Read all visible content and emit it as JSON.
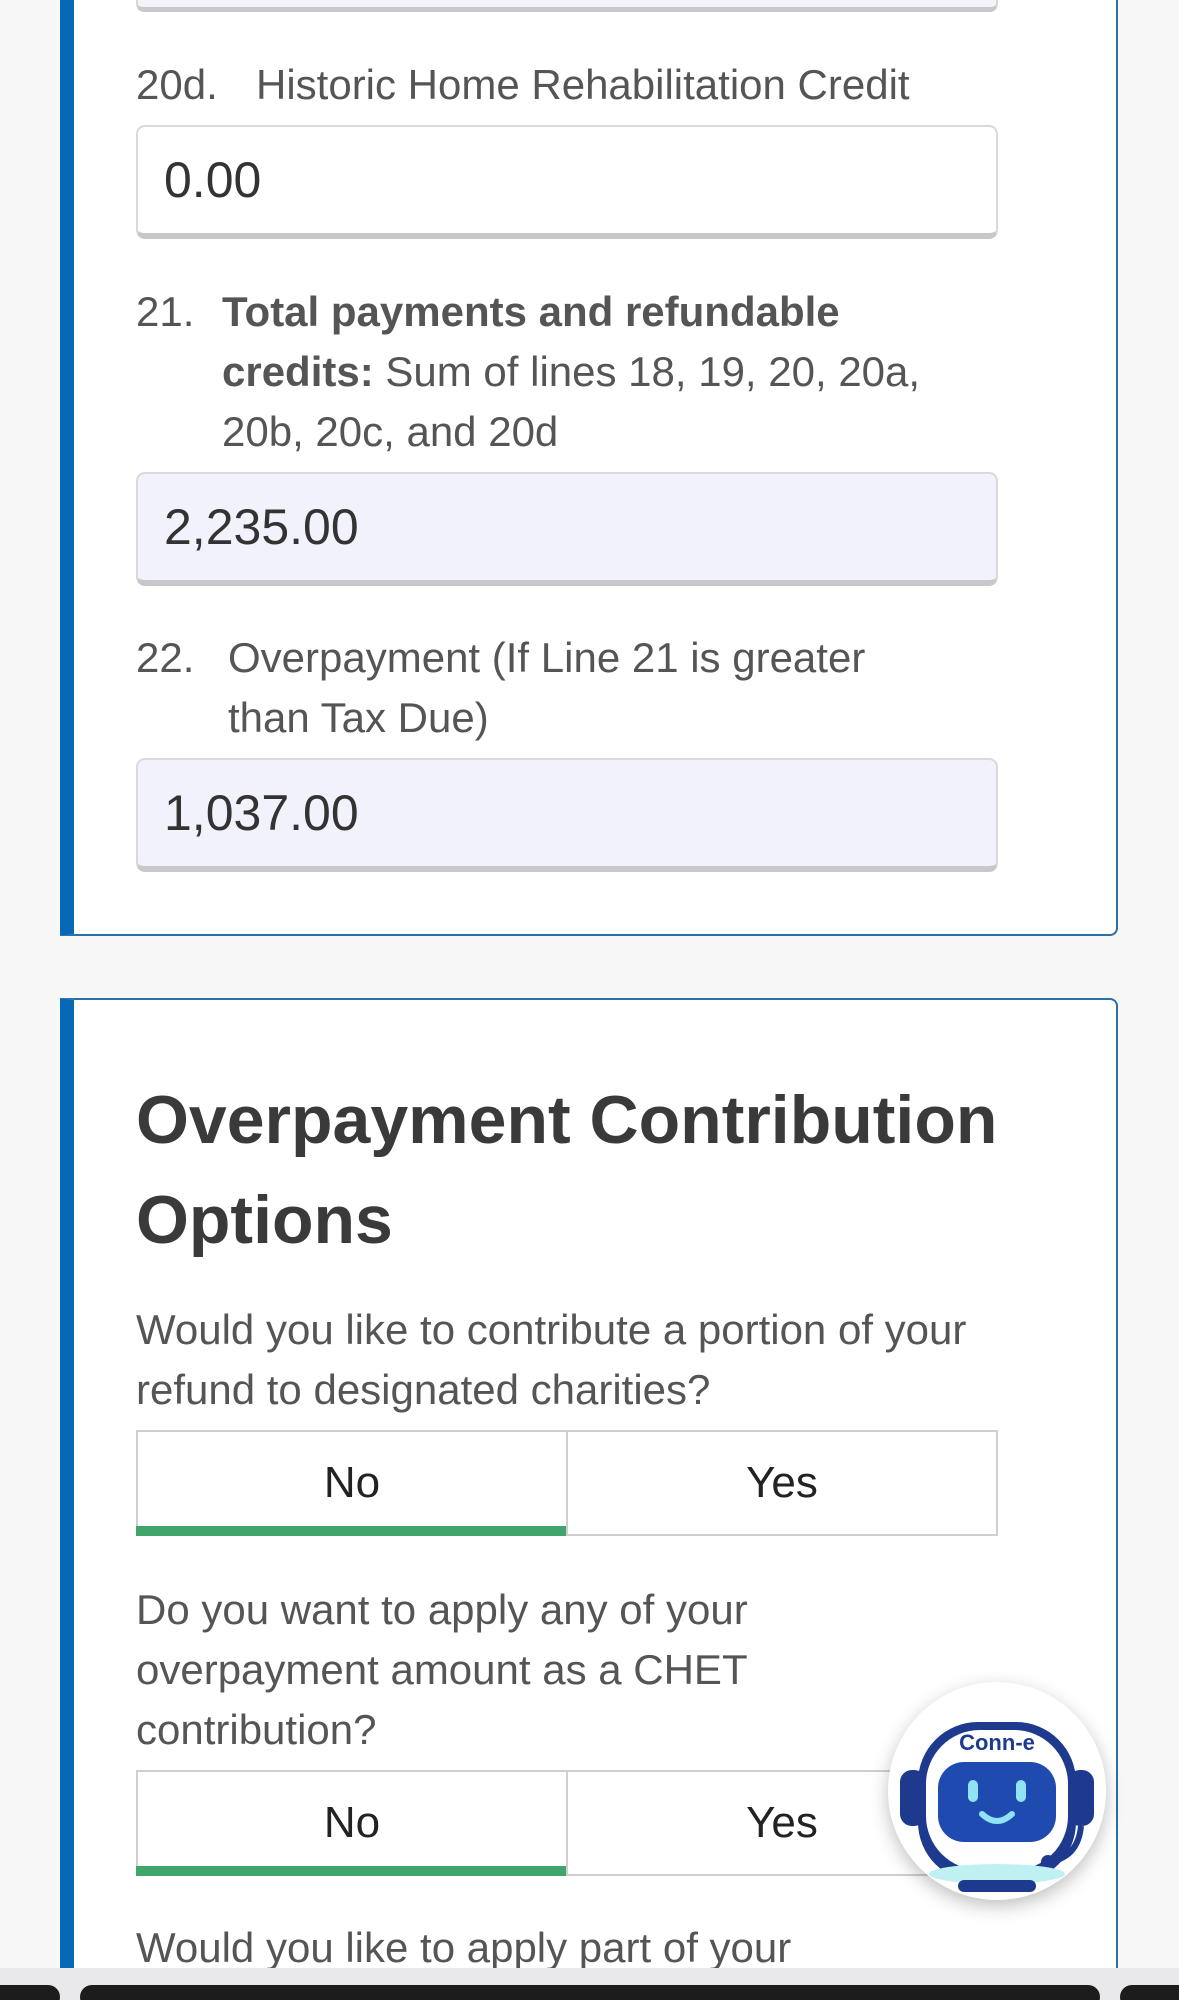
{
  "lines": {
    "l20d": {
      "num": "20d.",
      "text": "Historic Home Rehabilitation Credit",
      "value": "0.00"
    },
    "l21": {
      "num": "21.",
      "bold": "Total payments and refundable credits:",
      "text": "Sum of lines 18, 19, 20, 20a, 20b, 20c, and 20d",
      "value": "2,235.00"
    },
    "l22": {
      "num": "22.",
      "text": "Overpayment (If Line 21 is greater than Tax Due)",
      "value": "1,037.00"
    }
  },
  "contributions": {
    "title": "Overpayment Contribution Options",
    "q1": {
      "text": "Would you like to contribute a portion of your refund to designated charities?",
      "no": "No",
      "yes": "Yes",
      "selected": "No"
    },
    "q2": {
      "text": "Do you want to apply any of your overpayment amount as a CHET contribution?",
      "no": "No",
      "yes": "Yes",
      "selected": "No"
    },
    "q3": {
      "text": "Would you like to apply part of your"
    }
  },
  "bot": {
    "name": "Conn-e"
  }
}
